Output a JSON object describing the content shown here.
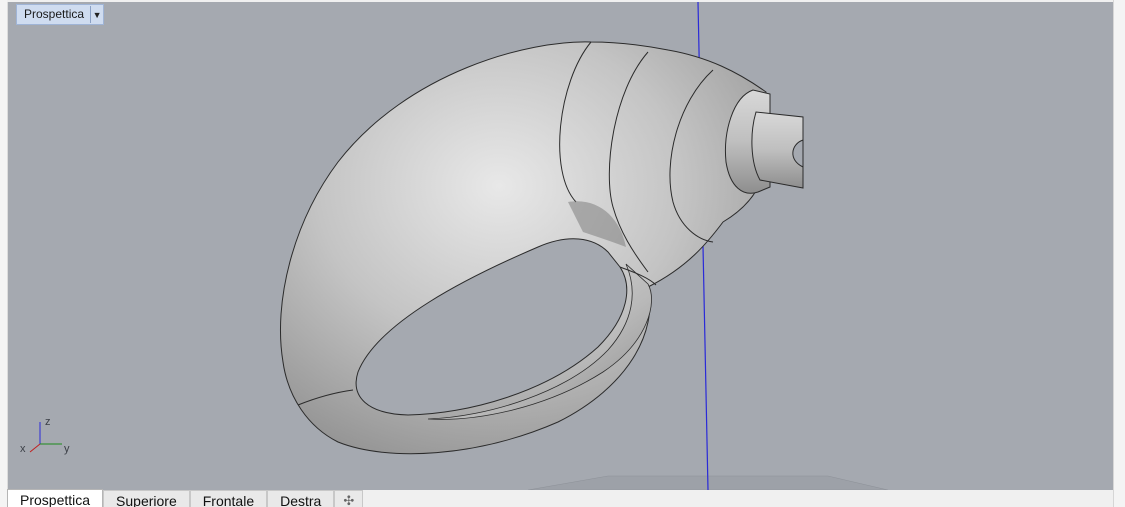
{
  "viewport": {
    "title": "Prospettica",
    "menu_icon": "triangle-down-icon"
  },
  "axes": {
    "z": "z",
    "x": "x",
    "y": "y"
  },
  "tabs": [
    {
      "label": "Prospettica",
      "active": true
    },
    {
      "label": "Superiore",
      "active": false
    },
    {
      "label": "Frontale",
      "active": false
    },
    {
      "label": "Destra",
      "active": false
    }
  ],
  "add_tab_icon": "plus-icon",
  "colors": {
    "background": "#a5a9b0",
    "surface": "#c9c9c9",
    "z_axis": "#2a2ad8"
  }
}
